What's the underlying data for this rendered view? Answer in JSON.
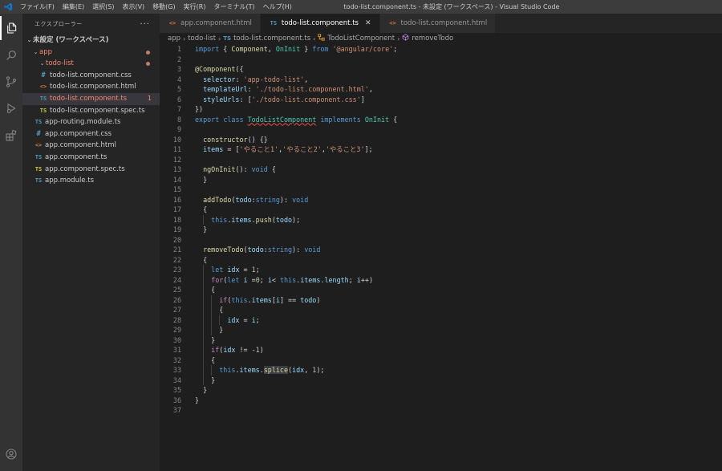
{
  "menu": [
    "ファイル(F)",
    "編集(E)",
    "選択(S)",
    "表示(V)",
    "移動(G)",
    "実行(R)",
    "ターミナル(T)",
    "ヘルプ(H)"
  ],
  "window_title": "todo-list.component.ts - 未設定 (ワークスペース) - Visual Studio Code",
  "activity_icons": [
    "explorer-icon",
    "search-icon",
    "source-control-icon",
    "run-debug-icon",
    "extensions-icon",
    "account-icon"
  ],
  "sidebar": {
    "title": "エクスプローラー",
    "more": "···",
    "workspace": "未設定 (ワークスペース)",
    "folder_app": "app",
    "folder_todo": "todo-list",
    "todo_files": [
      {
        "name": "todo-list.component.css",
        "icon": "#"
      },
      {
        "name": "todo-list.component.html",
        "icon": "<>"
      },
      {
        "name": "todo-list.component.ts",
        "icon": "TS",
        "badge": "1"
      },
      {
        "name": "todo-list.component.spec.ts",
        "icon": "TS"
      }
    ],
    "app_files": [
      {
        "name": "app-routing.module.ts",
        "icon": "TS"
      },
      {
        "name": "app.component.css",
        "icon": "#"
      },
      {
        "name": "app.component.html",
        "icon": "<>"
      },
      {
        "name": "app.component.ts",
        "icon": "TS"
      },
      {
        "name": "app.component.spec.ts",
        "icon": "TS"
      },
      {
        "name": "app.module.ts",
        "icon": "TS"
      }
    ]
  },
  "tabs": [
    {
      "label": "app.component.html",
      "icon": "<>"
    },
    {
      "label": "todo-list.component.ts",
      "icon": "TS",
      "close": "✕"
    },
    {
      "label": "todo-list.component.html",
      "icon": "<>"
    }
  ],
  "breadcrumb": {
    "items": [
      "app",
      "todo-list",
      "todo-list.component.ts",
      "TodoListComponent",
      "removeTodo"
    ],
    "ts_icon": "TS"
  },
  "code_lines": [
    "import { Component, OnInit } from '@angular/core';",
    "",
    "@Component({",
    "  selector: 'app-todo-list',",
    "  templateUrl: './todo-list.component.html',",
    "  styleUrls: ['./todo-list.component.css']",
    "})",
    "export class TodoListComponent implements OnInit {",
    "",
    "  constructor() {}",
    "  items = ['やること1','やること2','やること3'];",
    "",
    "  ngOnInit(): void {",
    "  }",
    "",
    "  addTodo(todo:string): void",
    "  {",
    "    this.items.push(todo);",
    "  }",
    "",
    "  removeTodo(todo:string): void",
    "  {",
    "    let idx = 1;",
    "    for(let i =0; i< this.items.length; i++)",
    "    {",
    "      if(this.items[i] == todo)",
    "      {",
    "        idx = i;",
    "      }",
    "    }",
    "    if(idx != -1)",
    "    {",
    "      this.items.splice(idx, 1);",
    "    }",
    "  }",
    "}",
    ""
  ],
  "colors": {
    "keyword": "#569cd6",
    "control": "#c586c0",
    "string": "#ce9178",
    "function": "#dcdcaa",
    "type": "#4ec9b0",
    "variable": "#9cdcfe",
    "number": "#b5cea8",
    "error": "#f48771"
  }
}
